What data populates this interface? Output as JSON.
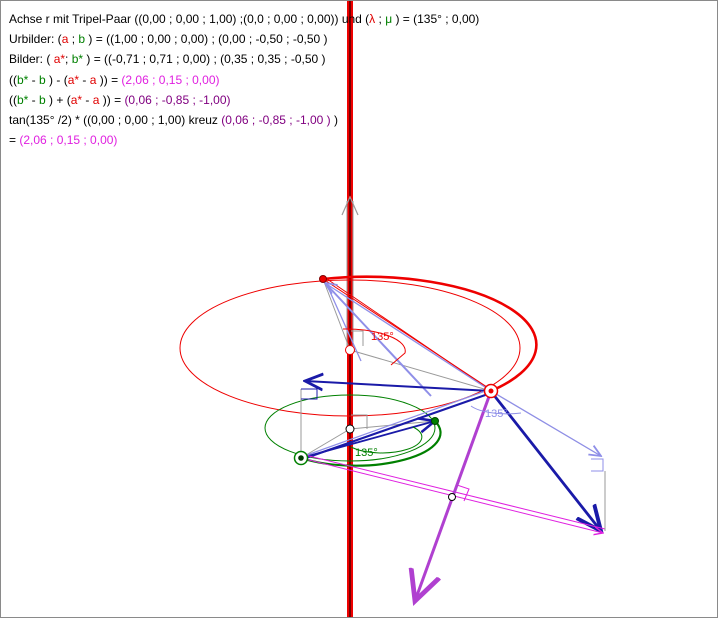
{
  "text": {
    "line1": {
      "prefix": "Achse r mit Tripel-Paar ((0,00 ; 0,00 ; 1,00) ;(0,0 ; 0,00 ; 0,00)) und (",
      "lambda": "λ",
      "sep": " ; ",
      "mu": "μ",
      "suffix": "  ) = (135° ; 0,00)"
    },
    "line2": {
      "prefix": "Urbilder: (",
      "a": "a",
      "sep": "  ;  ",
      "b": "b",
      "suffix": "  ) =  ((1,00 ; 0,00 ; 0,00) ; (0,00 ; -0,50 ; -0,50 )"
    },
    "line3": {
      "prefix": "Bilder: (   ",
      "a": "a*",
      "sep": ";  ",
      "b": "b*",
      "suffix": "  ) =  ((-0,71 ; 0,71 ; 0,00) ; (0,35 ; 0,35 ; -0,50 )"
    },
    "line4": {
      "p1": "((",
      "bs": "b*",
      "m1": " - ",
      "b": "b",
      "m2": " ) - (",
      "as": "a*",
      "m3": " - ",
      "a": "a",
      "m4": " )) = ",
      "result": "(2,06 ; 0,15 ; 0,00)"
    },
    "line5": {
      "p1": "((",
      "bs": "b*",
      "m1": " - ",
      "b": "b",
      "m2": " ) + (",
      "as": "a*",
      "m3": " - ",
      "a": "a",
      "m4": " )) = ",
      "result": "(0,06 ; -0,85 ; -1,00)"
    },
    "line6": {
      "prefix": "tan(135° /2) * ((0,00 ; 0,00 ; 1,00) kreuz ",
      "vec": "(0,06 ; -0,85 ; -1,00 )",
      "suffix": "  )"
    },
    "line7": {
      "eq": "= ",
      "result": "(2,06 ; 0,15 ; 0,00)"
    }
  },
  "diagram": {
    "angle_label": "135°"
  },
  "colors": {
    "axis": "#ee0000",
    "a_circle": "#ee0000",
    "b_circle": "#008000",
    "vector_dark_blue": "#1a1aa8",
    "vector_light_blue": "#8f8fe8",
    "vector_magenta": "#e020e0",
    "vector_purple": "#b040d0",
    "vector_gray": "#9a9a9a"
  }
}
